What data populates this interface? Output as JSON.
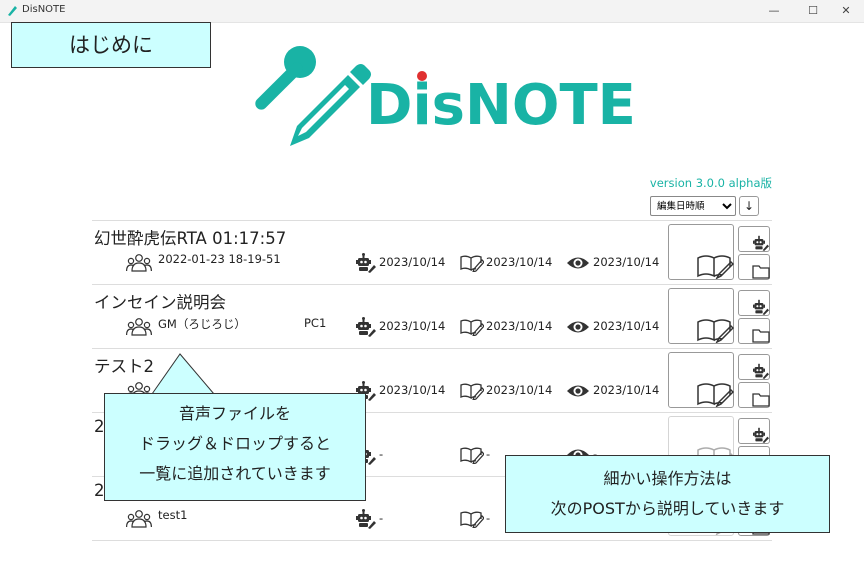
{
  "window": {
    "title": "DisNOTE",
    "min_glyph": "—",
    "max_glyph": "☐",
    "close_glyph": "✕"
  },
  "logo": {
    "text": "DisNOTE",
    "accent": "#19b3a5"
  },
  "version": "version 3.0.0 alpha版",
  "sort": {
    "selected": "編集日時順",
    "button_glyph": "↓"
  },
  "rows": [
    {
      "title": "幻世酔虎伝RTA 01:17:57",
      "subtitle": "2022-01-23 18-19-51",
      "pc": "",
      "recognized": "2023/10/14",
      "edited": "2023/10/14",
      "viewed": "2023/10/14",
      "disabled": false
    },
    {
      "title": "インセイン説明会",
      "subtitle": "GM（ろじろじ）",
      "pc": "PC1",
      "recognized": "2023/10/14",
      "edited": "2023/10/14",
      "viewed": "2023/10/14",
      "disabled": false
    },
    {
      "title": "テスト2",
      "subtitle": "",
      "pc": "",
      "recognized": "2023/10/14",
      "edited": "2023/10/14",
      "viewed": "2023/10/14",
      "disabled": false
    },
    {
      "title": "2",
      "subtitle": "",
      "pc": "",
      "recognized": "-",
      "edited": "-",
      "viewed": "-",
      "disabled": true
    },
    {
      "title": "2",
      "subtitle": "test1",
      "pc": "",
      "recognized": "-",
      "edited": "-",
      "viewed": "",
      "disabled": true
    }
  ],
  "callouts": {
    "hajime": "はじめに",
    "drag": [
      "音声ファイルを",
      "ドラッグ＆ドロップすると",
      "一覧に追加されていきます"
    ],
    "operation": [
      "細かい操作方法は",
      "次のPOSTから説明していきます"
    ]
  },
  "icons": {
    "speaker": "people-icon",
    "recognized": "robot-icon",
    "edited": "edit-book-icon",
    "viewed": "eye-icon",
    "open": "open-book-icon",
    "folder": "folder-icon"
  }
}
